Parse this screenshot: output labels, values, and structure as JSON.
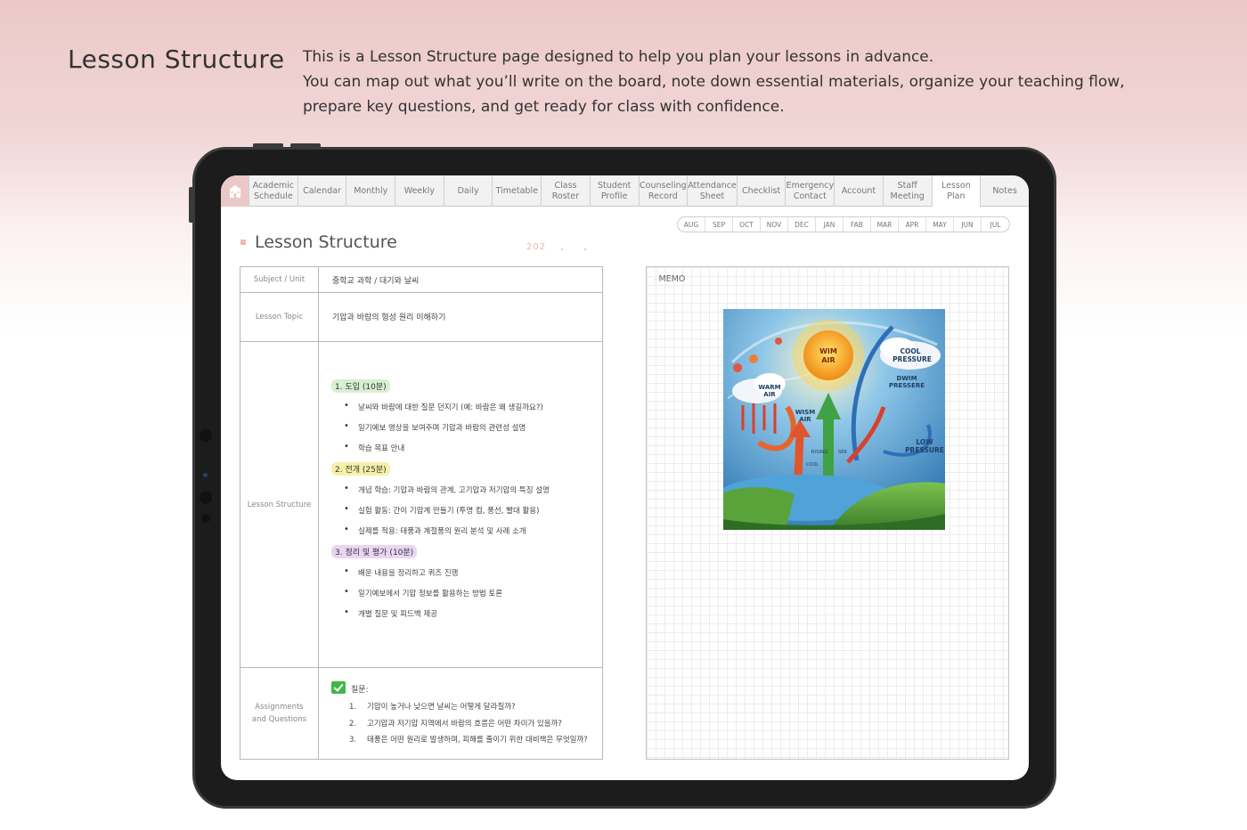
{
  "promo": {
    "title": "Lesson Structure",
    "desc_line1": "This is a Lesson Structure page designed to help you plan your lessons in advance.",
    "desc_line2": "You can map out what you’ll write on the board, note down essential materials, organize your teaching flow,",
    "desc_line3": "prepare key questions, and get  ready for class with confidence."
  },
  "tabs": [
    {
      "label": "Academic\nSchedule"
    },
    {
      "label": "Calendar"
    },
    {
      "label": "Monthly"
    },
    {
      "label": "Weekly"
    },
    {
      "label": "Daily"
    },
    {
      "label": "Timetable"
    },
    {
      "label": "Class Roster"
    },
    {
      "label": "Student\nProfile"
    },
    {
      "label": "Counseling\nRecord"
    },
    {
      "label": "Attendance\nSheet"
    },
    {
      "label": "Checklist"
    },
    {
      "label": "Emergency\nContact"
    },
    {
      "label": "Account"
    },
    {
      "label": "Staff\nMeeting"
    },
    {
      "label": "Lesson Plan",
      "active": true
    },
    {
      "label": "Notes"
    }
  ],
  "months": [
    "AUG",
    "SEP",
    "OCT",
    "NOV",
    "DEC",
    "JAN",
    "FAB",
    "MAR",
    "APR",
    "MAY",
    "JUN",
    "JUL"
  ],
  "page": {
    "title": "Lesson Structure",
    "year": "202"
  },
  "table": {
    "subject_label": "Subject / Unit",
    "subject_value": "중학교 과학 / 대기와 날씨",
    "topic_label": "Lesson Topic",
    "topic_value": "기압과 바람의 형성 원리 이해하기",
    "structure_label": "Lesson Structure",
    "sections": [
      {
        "title": "1. 도입 (10분)",
        "items": [
          "날씨와 바람에 대한 질문 던지기 (예: 바람은 왜 생길까요?)",
          "일기예보 영상을 보여주며 기압과 바람의 관련성 설명",
          "학습 목표 안내"
        ]
      },
      {
        "title": "2. 전개 (25분)",
        "items": [
          "개념 학습: 기압과 바람의 관계, 고기압과 저기압의 특징 설명",
          "실험 활동: 간이 기압계 만들기 (투명 컵, 풍선, 빨대 활용)",
          "실제를 적용: 태풍과 계절풍의 원리 분석 및 사례 소개"
        ]
      },
      {
        "title": "3. 정리 및 평가 (10분)",
        "items": [
          "배운 내용을 정리하고 퀴즈 진행",
          "일기예보에서 기압 정보를 활용하는 방법 토론",
          "개별 질문 및 피드백 제공"
        ]
      }
    ],
    "assign_label": "Assignments\nand Questions",
    "questions_head": "질문:",
    "questions": [
      {
        "n": "1.",
        "text": "기압이 높거나 낮으면 날씨는 어떻게 달라질까?"
      },
      {
        "n": "2.",
        "text": "고기압과 저기압 지역에서 바람의 흐름은 어떤 차이가 있을까?"
      },
      {
        "n": "3.",
        "text": "태풍은 어떤 원리로 발생하며, 피해를 줄이기 위한 대비책은 무엇일까?"
      }
    ]
  },
  "memo": {
    "label": "MEMO",
    "illustration": {
      "sun_text": [
        "WIM",
        "AIR"
      ],
      "cool_text": [
        "COOL",
        "PRESSURE"
      ],
      "low_text": [
        "LOW",
        "PRESSURE"
      ],
      "warm_text": [
        "WARM",
        "AIR"
      ],
      "wism_text": [
        "WISM",
        "AIR"
      ],
      "press_text": [
        "DWIM",
        "PRESSERE"
      ],
      "rising_text": "RISING",
      "ser_text": "SER",
      "cool_small": "COOL",
      "sky_color": "#3f8fc9",
      "sun_color": "#f6b21f",
      "grass_color": "#5aa33b"
    }
  }
}
